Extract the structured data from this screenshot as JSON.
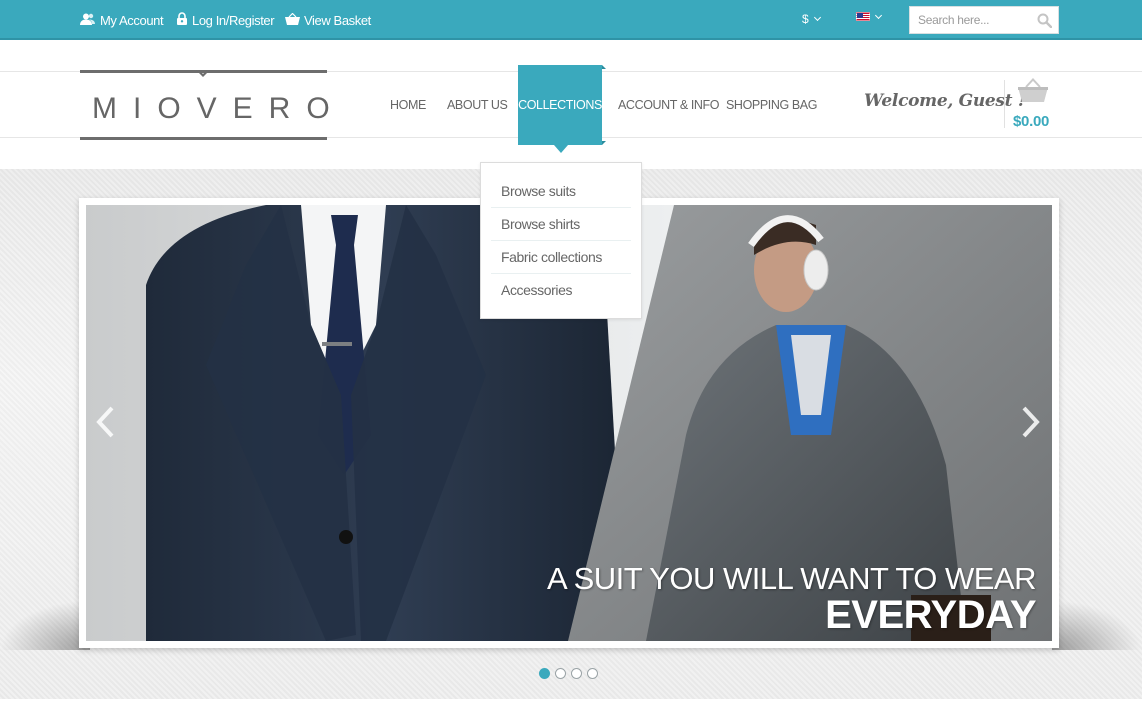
{
  "topbar": {
    "account_label": "My Account",
    "login_label": "Log In/Register",
    "basket_label": "View Basket",
    "currency": "$",
    "search_placeholder": "Search here..."
  },
  "header": {
    "logo_text": "MIOVERO",
    "nav": [
      "HOME",
      "ABOUT US",
      "COLLECTIONS",
      "ACCOUNT & INFO",
      "SHOPPING BAG"
    ],
    "active_nav": "COLLECTIONS",
    "welcome": "Welcome, Guest !",
    "cart_total": "$0.00"
  },
  "dropdown": {
    "items": [
      "Browse suits",
      "Browse shirts",
      "Fabric collections",
      "Accessories"
    ]
  },
  "slider": {
    "caption_line1": "A SUIT YOU WILL WANT TO WEAR",
    "caption_line2": "EVERYDAY",
    "slide_count": 4,
    "active_slide": 1
  },
  "colors": {
    "accent": "#3aa9bd",
    "text": "#666666"
  }
}
